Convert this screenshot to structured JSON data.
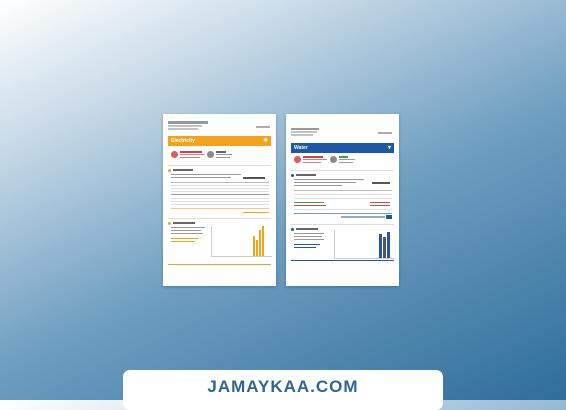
{
  "left_page": {
    "title": "Electricity",
    "accent": "#f5a21b",
    "icon": "bulb-icon"
  },
  "right_page": {
    "title": "Water",
    "accent": "#1e56a8",
    "icon": "water-drop-icon"
  },
  "footer": {
    "site": "JAMAYKAA.COM"
  }
}
